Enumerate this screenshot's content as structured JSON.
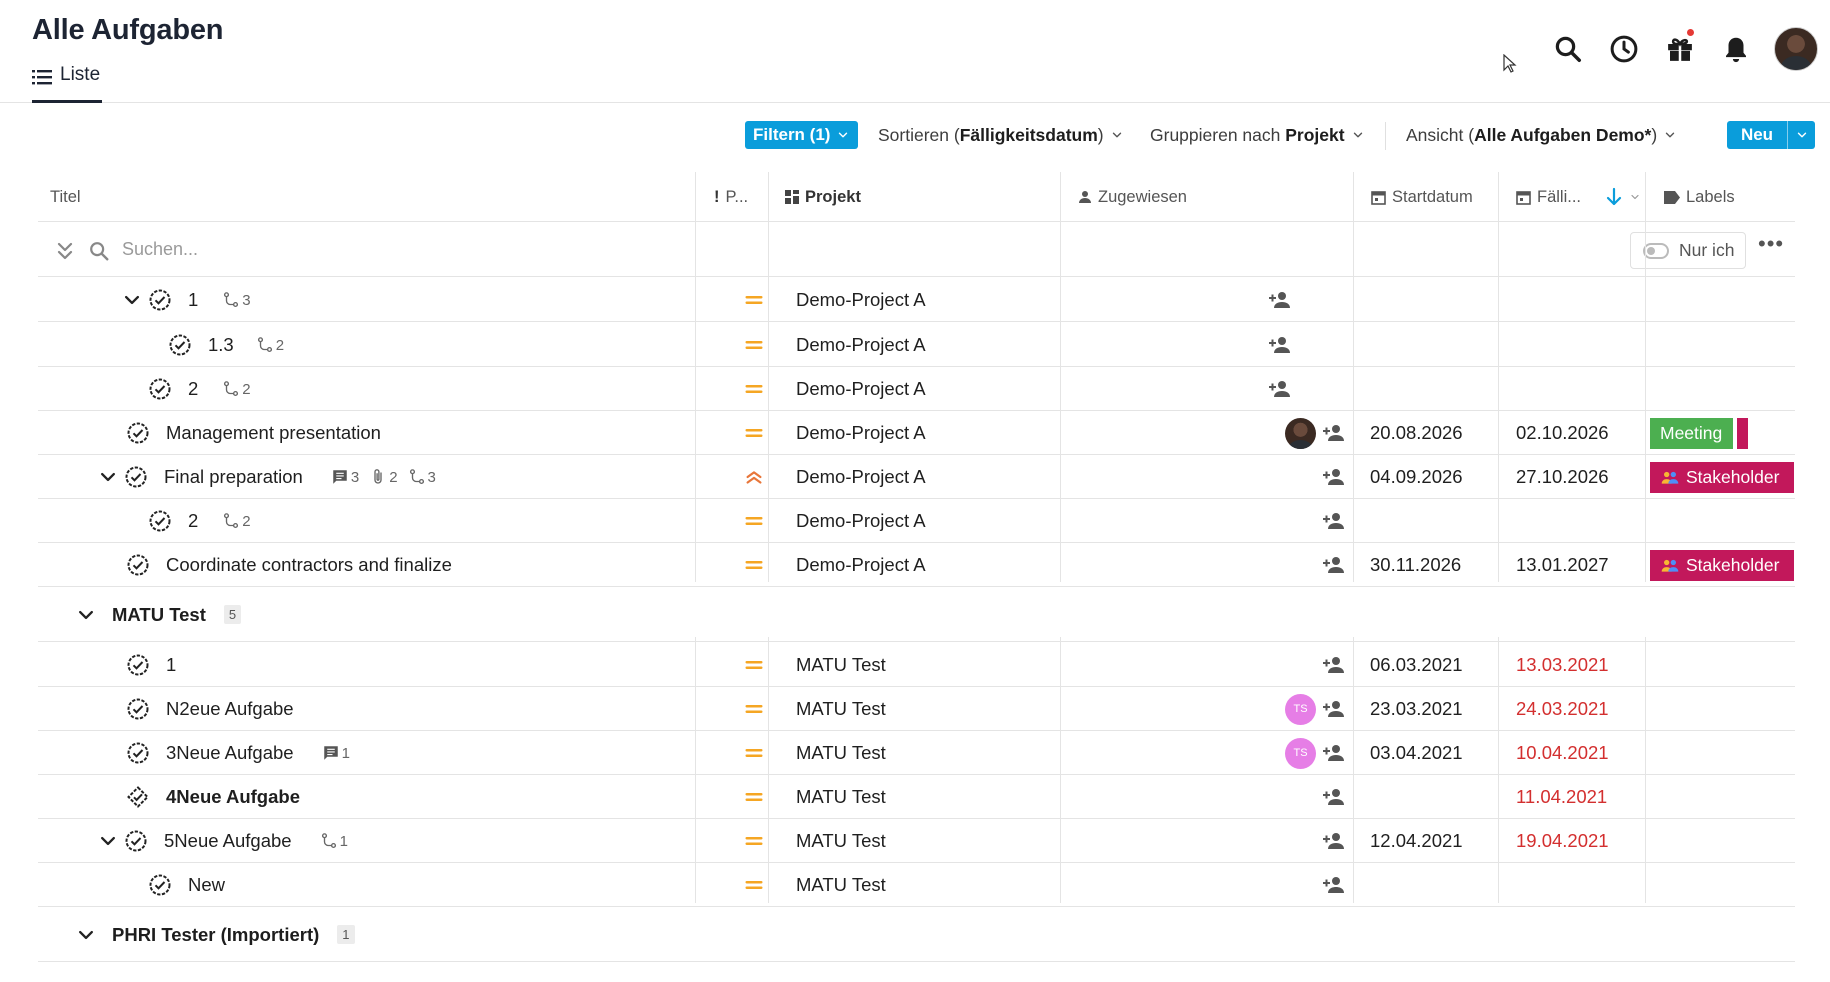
{
  "header": {
    "title": "Alle Aufgaben",
    "view_tab": "Liste"
  },
  "toolbar": {
    "filter": "Filtern (1)",
    "sort_prefix": "Sortieren (",
    "sort_value": "Fälligkeitsdatum",
    "sort_suffix": ")",
    "group_prefix": "Gruppieren nach",
    "group_value": "Projekt",
    "view_prefix": "Ansicht (",
    "view_value": "Alle Aufgaben Demo*",
    "view_suffix": ")",
    "new": "Neu"
  },
  "columns": {
    "title": "Titel",
    "priority": "P...",
    "project": "Projekt",
    "assigned": "Zugewiesen",
    "start": "Startdatum",
    "due": "Fälli...",
    "labels": "Labels"
  },
  "search": {
    "placeholder": "Suchen...",
    "only_me": "Nur ich"
  },
  "rows": [
    {
      "title": "1",
      "subtasks": "3",
      "project": "Demo-Project A",
      "prio": "medium"
    },
    {
      "title": "1.3",
      "subtasks": "2",
      "project": "Demo-Project A",
      "prio": "medium"
    },
    {
      "title": "2",
      "subtasks": "2",
      "project": "Demo-Project A",
      "prio": "medium"
    },
    {
      "title": "Management presentation",
      "project": "Demo-Project A",
      "prio": "medium",
      "start": "20.08.2026",
      "due": "02.10.2026",
      "label": "Meeting"
    },
    {
      "title": "Final preparation",
      "comments": "3",
      "attachments": "2",
      "subtasks": "3",
      "project": "Demo-Project A",
      "prio": "high",
      "start": "04.09.2026",
      "due": "27.10.2026",
      "label": "Stakeholder"
    },
    {
      "title": "2",
      "subtasks": "2",
      "project": "Demo-Project A",
      "prio": "medium"
    },
    {
      "title": "Coordinate contractors and finalize",
      "project": "Demo-Project A",
      "prio": "medium",
      "start": "30.11.2026",
      "due": "13.01.2027",
      "label": "Stakeholder"
    },
    {
      "title": "1",
      "project": "MATU Test",
      "prio": "medium",
      "start": "06.03.2021",
      "due": "13.03.2021"
    },
    {
      "title": "N2eue Aufgabe",
      "project": "MATU Test",
      "prio": "medium",
      "start": "23.03.2021",
      "due": "24.03.2021",
      "assignee": "TS"
    },
    {
      "title": "3Neue Aufgabe",
      "comments": "1",
      "project": "MATU Test",
      "prio": "medium",
      "start": "03.04.2021",
      "due": "10.04.2021",
      "assignee": "TS"
    },
    {
      "title": "4Neue Aufgabe",
      "project": "MATU Test",
      "prio": "medium",
      "due": "11.04.2021"
    },
    {
      "title": "5Neue Aufgabe",
      "subtasks": "1",
      "project": "MATU Test",
      "prio": "medium",
      "start": "12.04.2021",
      "due": "19.04.2021"
    },
    {
      "title": "New",
      "project": "MATU Test",
      "prio": "medium"
    }
  ],
  "groups": [
    {
      "name": "MATU Test",
      "count": "5"
    },
    {
      "name": "PHRI Tester (Importiert)",
      "count": "1"
    }
  ],
  "colors": {
    "accent": "#0a9ddb",
    "priority_medium": "#f5a623",
    "priority_high": "#e8763a",
    "overdue": "#d32f2f",
    "meeting": "#4caf50",
    "stakeholder": "#c2185b",
    "ts_avatar": "#e67ee6"
  }
}
